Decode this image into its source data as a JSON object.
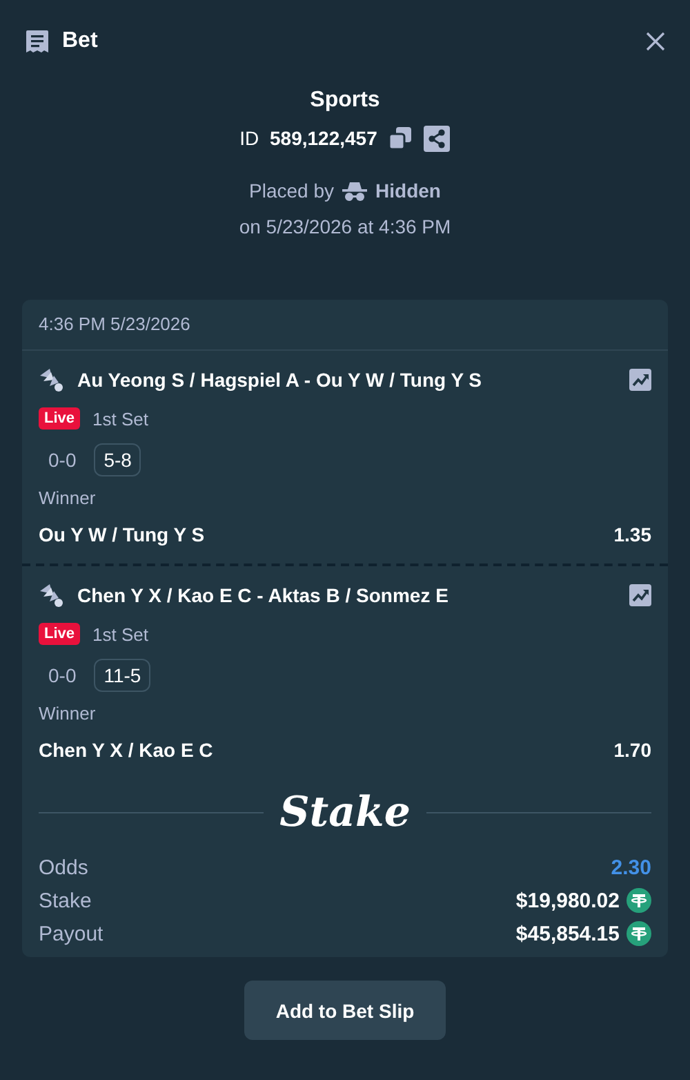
{
  "header": {
    "title": "Bet"
  },
  "bet": {
    "category": "Sports",
    "id_label": "ID",
    "id_value": "589,122,457",
    "placed_by_label": "Placed by",
    "placed_by_user": "Hidden",
    "placed_on": "on 5/23/2026 at 4:36 PM"
  },
  "card": {
    "timestamp": "4:36 PM 5/23/2026",
    "legs": [
      {
        "event": "Au Yeong S / Hagspiel A - Ou Y W / Tung Y S",
        "live": true,
        "live_label": "Live",
        "period": "1st Set",
        "scores": [
          {
            "text": "0-0",
            "current": false
          },
          {
            "text": "5-8",
            "current": true
          }
        ],
        "market": "Winner",
        "selection": "Ou Y W / Tung Y S",
        "odds": "1.35"
      },
      {
        "event": "Chen Y X / Kao E C - Aktas B / Sonmez E",
        "live": true,
        "live_label": "Live",
        "period": "1st Set",
        "scores": [
          {
            "text": "0-0",
            "current": false
          },
          {
            "text": "11-5",
            "current": true
          }
        ],
        "market": "Winner",
        "selection": "Chen Y X / Kao E C",
        "odds": "1.70"
      }
    ],
    "logo": "Stake",
    "summary": [
      {
        "kind": "odds",
        "label": "Odds",
        "value": "2.30"
      },
      {
        "kind": "amount",
        "label": "Stake",
        "value": "$19,980.02"
      },
      {
        "kind": "amount",
        "label": "Payout",
        "value": "$45,854.15"
      }
    ]
  },
  "button": "Add to Bet Slip"
}
